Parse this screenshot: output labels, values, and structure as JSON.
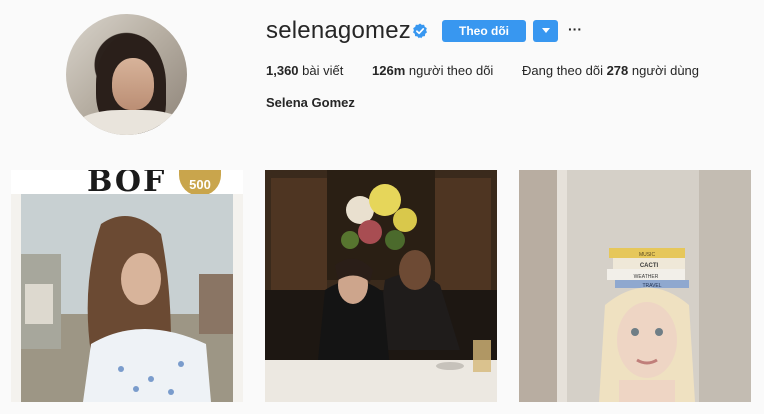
{
  "profile": {
    "username": "selenagomez",
    "verified": true,
    "full_name": "Selena Gomez",
    "follow_label": "Theo dõi",
    "more_label": "···"
  },
  "stats": {
    "posts_count": "1,360",
    "posts_label": "bài viết",
    "followers_count": "126m",
    "followers_label": "người theo dõi",
    "following_prefix": "Đang theo dõi",
    "following_count": "278",
    "following_suffix": "người dùng"
  },
  "posts": [
    {
      "title_text": "BOF",
      "badge_text": "500"
    },
    {
      "title_text": ""
    },
    {
      "book_labels": [
        "MUSIC",
        "CACTI",
        "WEATHER",
        "TRAVEL"
      ]
    }
  ],
  "colors": {
    "accent": "#3897f0",
    "background": "#fafafa",
    "text": "#262626"
  },
  "icons": {
    "verified": "verified-badge-icon",
    "dropdown": "chevron-down-icon",
    "more": "more-options-icon"
  }
}
